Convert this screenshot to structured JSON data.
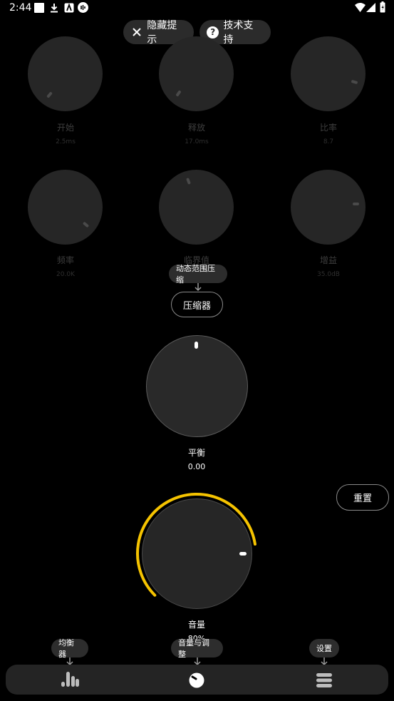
{
  "status_bar": {
    "time": "2:44"
  },
  "top": {
    "hide_tips": "隐藏提示",
    "tech_support": "技术支持"
  },
  "knobs": [
    {
      "label": "开始",
      "value": "2.5ms"
    },
    {
      "label": "释放",
      "value": "17.0ms"
    },
    {
      "label": "比率",
      "value": "8.7"
    },
    {
      "label": "频率",
      "value": "20.0K"
    },
    {
      "label": "临界值",
      "value": ""
    },
    {
      "label": "增益",
      "value": "35.0dB"
    }
  ],
  "compressor": {
    "tooltip": "动态范围压缩",
    "button": "压缩器"
  },
  "balance": {
    "label": "平衡",
    "value": "0.00"
  },
  "reset": "重置",
  "volume": {
    "label": "音量",
    "value": "80%",
    "level_fraction": 0.8,
    "accent": "#f5c300"
  },
  "nav": {
    "equalizer_tip": "均衡器",
    "volume_tip": "音量与调整",
    "settings_tip": "设置"
  }
}
